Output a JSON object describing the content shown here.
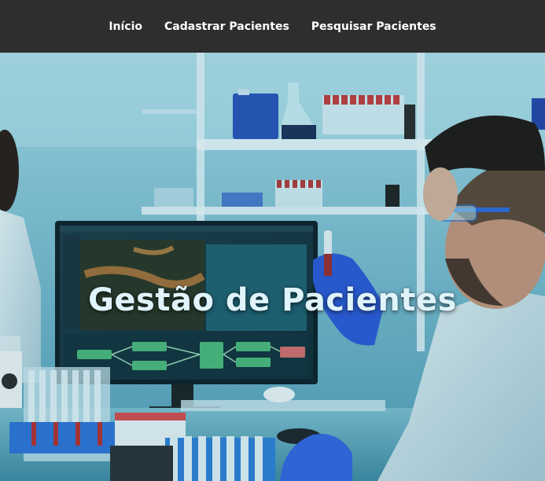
{
  "nav": {
    "items": [
      {
        "label": "Início"
      },
      {
        "label": "Cadastrar Pacientes"
      },
      {
        "label": "Pesquisar Pacientes"
      }
    ]
  },
  "hero": {
    "title": "Gestão de Pacientes",
    "image": "laboratory-scientists-photo"
  },
  "colors": {
    "navbar": "#2e2e2e",
    "nav_text": "#ffffff",
    "hero_title": "#dff3fa"
  }
}
